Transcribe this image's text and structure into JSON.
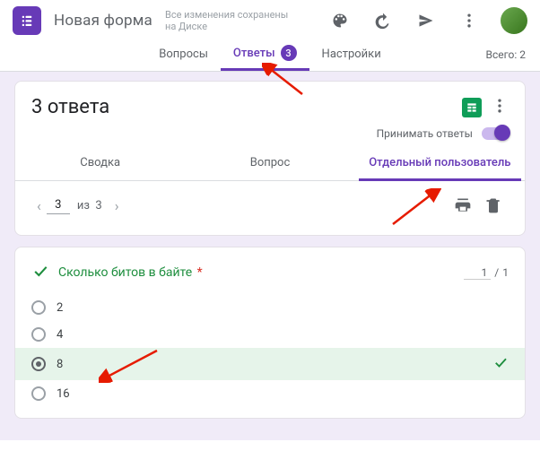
{
  "header": {
    "title": "Новая форма",
    "save_line1": "Все изменения сохранены",
    "save_line2": "на Диске"
  },
  "tabs": {
    "questions": "Вопросы",
    "answers": "Ответы",
    "answers_badge": "3",
    "settings": "Настройки",
    "total_prefix": "Всего: ",
    "total_count": "2"
  },
  "responses": {
    "heading": "3 ответа",
    "accept_label": "Принимать ответы",
    "sub_summary": "Сводка",
    "sub_question": "Вопрос",
    "sub_individual": "Отдельный пользователь",
    "pager_current": "3",
    "pager_of": "из",
    "pager_total": "3"
  },
  "question": {
    "text": "Сколько битов в байте",
    "score_value": "1",
    "score_sep": "/",
    "score_max": "1",
    "options": [
      {
        "label": "2",
        "selected": false,
        "correct": false
      },
      {
        "label": "4",
        "selected": false,
        "correct": false
      },
      {
        "label": "8",
        "selected": true,
        "correct": true
      },
      {
        "label": "16",
        "selected": false,
        "correct": false
      }
    ]
  }
}
